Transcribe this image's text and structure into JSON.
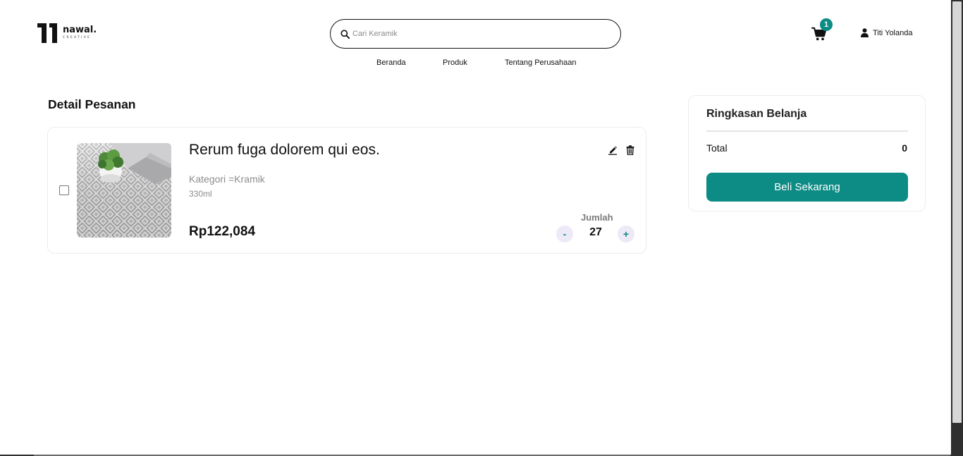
{
  "brand": {
    "name": "nawal.",
    "tagline": "CREATIVE"
  },
  "search": {
    "placeholder": "Cari Keramik",
    "value": ""
  },
  "nav": {
    "items": [
      {
        "label": "Beranda"
      },
      {
        "label": "Produk"
      },
      {
        "label": "Tentang Perusahaan"
      }
    ]
  },
  "cart": {
    "count": "1",
    "icon": "cart-icon"
  },
  "user": {
    "name": "Titi Yolanda",
    "icon": "user-icon"
  },
  "order": {
    "title": "Detail Pesanan",
    "items": [
      {
        "name": "Rerum fuga dolorem qui eos.",
        "category": "Kategori =Kramik",
        "size": "330ml",
        "price": "Rp122,084",
        "quantity_label": "Jumlah",
        "quantity": "27",
        "minus_label": "-",
        "plus_label": "+",
        "checked": false,
        "image": "ceramic-tile-floor-photo"
      }
    ]
  },
  "summary": {
    "title": "Ringkasan Belanja",
    "total_label": "Total",
    "total_value": "0",
    "buy_label": "Beli Sekarang"
  },
  "colors": {
    "accent": "#0d8b85",
    "qty_button_bg": "#ede9f7",
    "muted_text": "#8c8c8c"
  }
}
